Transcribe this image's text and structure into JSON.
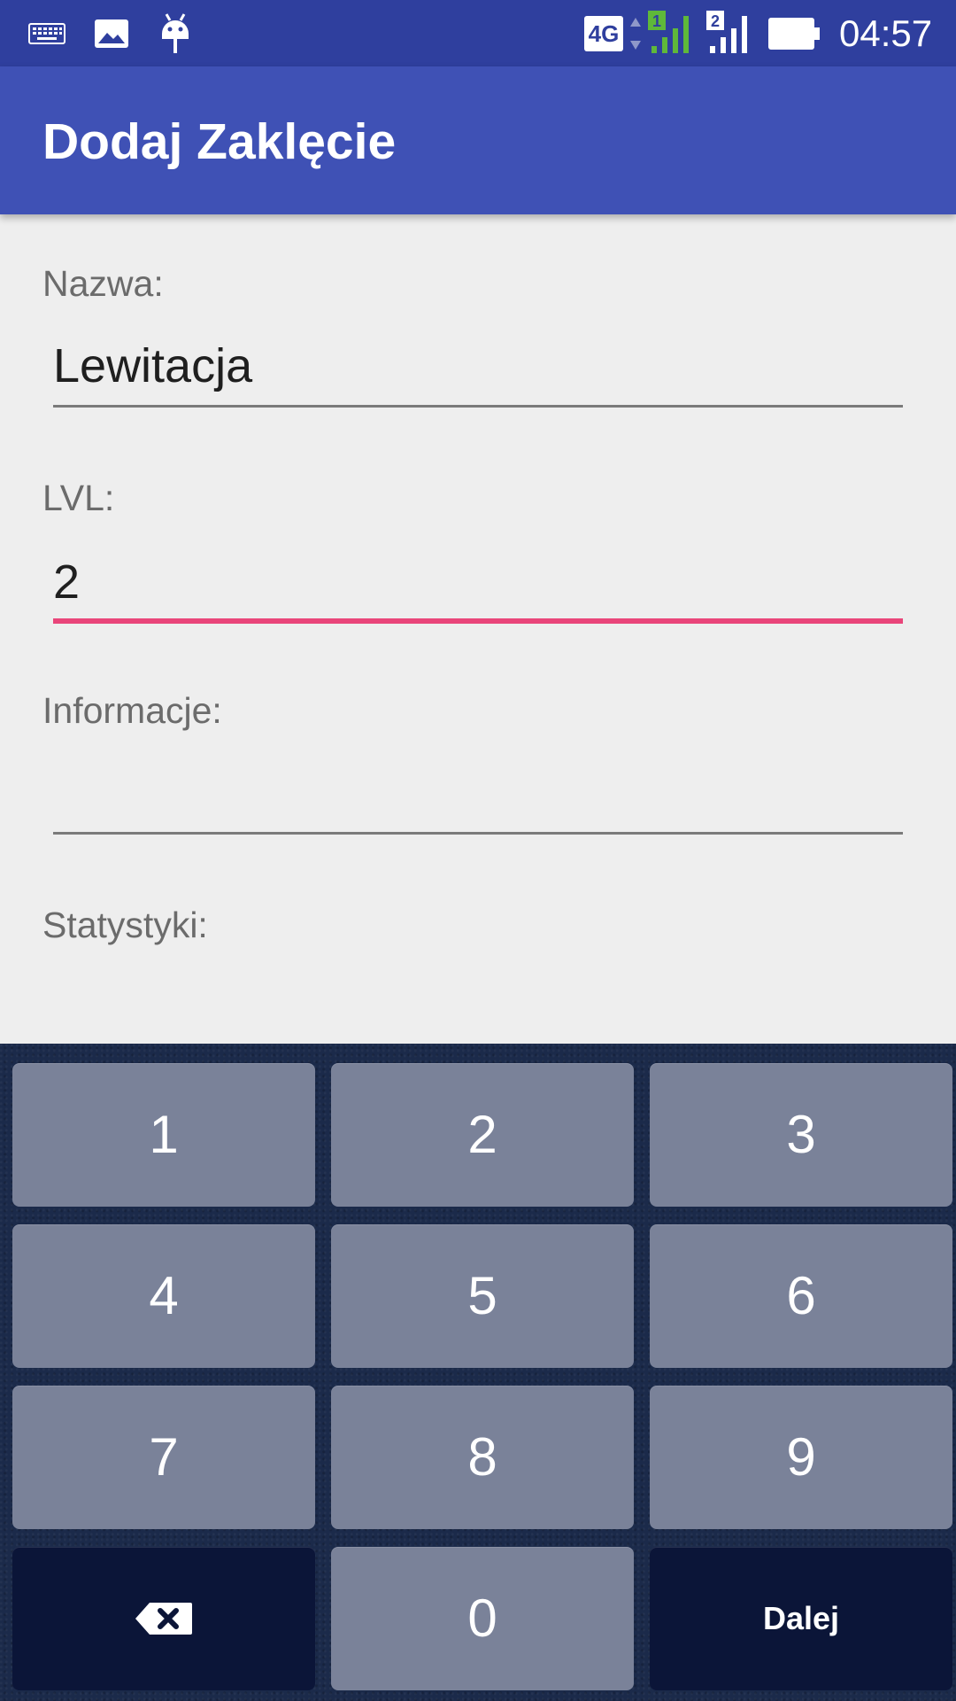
{
  "status_bar": {
    "network_type": "4G",
    "sim1_label": "1",
    "sim2_label": "2",
    "time": "04:57",
    "icons": [
      "keyboard-icon",
      "gallery-icon",
      "android-debug-icon",
      "data-arrows-icon",
      "signal-sim1-icon",
      "signal-sim2-icon",
      "battery-icon"
    ]
  },
  "app_bar": {
    "title": "Dodaj Zaklęcie",
    "color": "#3f51b5"
  },
  "form": {
    "name_label": "Nazwa:",
    "name_value": "Lewitacja",
    "lvl_label": "LVL:",
    "lvl_value": "2",
    "info_label": "Informacje:",
    "info_value": "",
    "stats_label": "Statystyki:",
    "focus_color": "#e9457a"
  },
  "keyboard": {
    "keys": [
      "1",
      "2",
      "3",
      "4",
      "5",
      "6",
      "7",
      "8",
      "9",
      "0"
    ],
    "backspace_icon": "backspace-icon",
    "action_label": "Dalej"
  }
}
